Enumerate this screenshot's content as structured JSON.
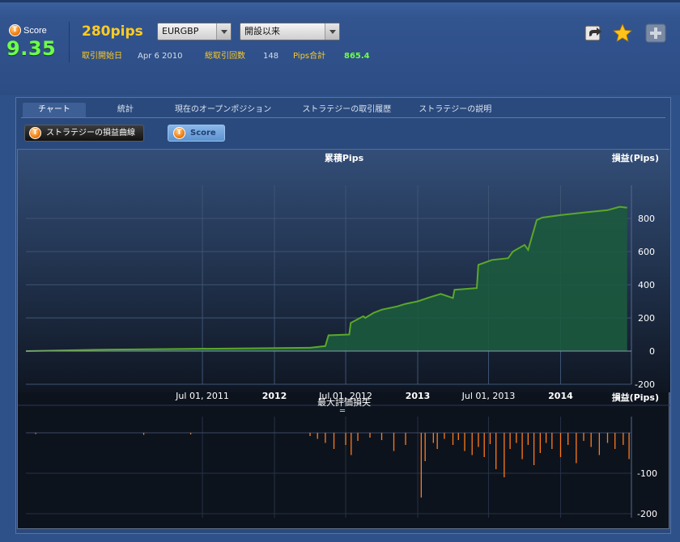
{
  "header": {
    "score_label": "Score",
    "score_value": "9.35",
    "strategy_name": "280pips",
    "pair_select": "EURGBP",
    "period_select": "開設以来",
    "start_label": "取引開始日",
    "start_date": "Apr 6 2010",
    "trades_label": "総取引回数",
    "trades_count": "148",
    "pips_label": "Pips合計",
    "pips_total": "865.4",
    "icons": [
      "share-icon",
      "star-icon",
      "add-icon"
    ]
  },
  "tabs": [
    "チャート",
    "統計",
    "現在のオープンポジション",
    "ストラテジーの取引履歴",
    "ストラテジーの説明"
  ],
  "buttons": {
    "curve": "ストラテジーの損益曲線",
    "score": "Score"
  },
  "colors": {
    "accent": "#ffcc22",
    "positive": "#6dff4a",
    "equity_line": "#5aa82a",
    "equity_fill": "#1c5a3e",
    "drawdown_bar": "#ff7b1a"
  },
  "chart_data": [
    {
      "type": "area",
      "title": "累積Pips",
      "ylabel": "損益(Pips)",
      "ylim": [
        -200,
        1000
      ],
      "yticks": [
        -200,
        0,
        200,
        400,
        600,
        800
      ],
      "x_tick_labels": [
        "Jul 01, 2011",
        "2012",
        "Jul 01, 2012",
        "2013",
        "Jul 01, 2013",
        "2014"
      ],
      "xlim": [
        "2010-04-06",
        "2014-07-01"
      ],
      "grid": true,
      "x": [
        "2010-04-06",
        "2010-10-01",
        "2011-04-01",
        "2011-10-01",
        "2012-04-01",
        "2012-05-10",
        "2012-05-18",
        "2012-07-10",
        "2012-07-14",
        "2012-08-15",
        "2012-08-20",
        "2012-09-10",
        "2012-10-01",
        "2012-11-10",
        "2012-12-01",
        "2013-01-01",
        "2013-02-01",
        "2013-03-01",
        "2013-04-01",
        "2013-04-05",
        "2013-06-01",
        "2013-06-05",
        "2013-07-10",
        "2013-08-20",
        "2013-09-01",
        "2013-10-01",
        "2013-10-10",
        "2013-11-01",
        "2013-11-15",
        "2014-01-01",
        "2014-03-01",
        "2014-05-01",
        "2014-06-01",
        "2014-06-20"
      ],
      "values": [
        0,
        8,
        12,
        16,
        20,
        30,
        95,
        100,
        170,
        210,
        200,
        230,
        250,
        270,
        285,
        300,
        325,
        345,
        320,
        370,
        380,
        520,
        550,
        560,
        600,
        640,
        610,
        790,
        805,
        820,
        835,
        850,
        870,
        865
      ]
    },
    {
      "type": "bar",
      "title": "最大評価損失",
      "ylabel": "損益(Pips)",
      "ylim": [
        -200,
        0
      ],
      "yticks": [
        -100,
        -200
      ],
      "x": [
        "2010-05-01",
        "2011-02-01",
        "2011-06-01",
        "2012-04-01",
        "2012-04-20",
        "2012-05-10",
        "2012-06-01",
        "2012-07-01",
        "2012-07-15",
        "2012-08-01",
        "2012-09-01",
        "2012-10-01",
        "2012-11-01",
        "2012-12-01",
        "2013-01-10",
        "2013-01-20",
        "2013-02-10",
        "2013-02-20",
        "2013-03-10",
        "2013-04-01",
        "2013-04-15",
        "2013-05-01",
        "2013-05-20",
        "2013-06-05",
        "2013-06-20",
        "2013-07-05",
        "2013-07-20",
        "2013-08-10",
        "2013-08-25",
        "2013-09-10",
        "2013-09-25",
        "2013-10-10",
        "2013-10-25",
        "2013-11-10",
        "2013-11-25",
        "2013-12-10",
        "2014-01-01",
        "2014-01-20",
        "2014-02-10",
        "2014-03-01",
        "2014-03-20",
        "2014-04-10",
        "2014-05-01",
        "2014-05-20",
        "2014-06-10",
        "2014-06-25"
      ],
      "values": [
        -3,
        -5,
        -4,
        -8,
        -15,
        -25,
        -40,
        -30,
        -55,
        -20,
        -12,
        -18,
        -45,
        -30,
        -160,
        -70,
        -25,
        -40,
        -15,
        -30,
        -18,
        -45,
        -55,
        -35,
        -60,
        -28,
        -90,
        -110,
        -40,
        -25,
        -65,
        -30,
        -80,
        -50,
        -25,
        -40,
        -60,
        -30,
        -75,
        -20,
        -35,
        -55,
        -25,
        -40,
        -30,
        -65
      ]
    }
  ]
}
